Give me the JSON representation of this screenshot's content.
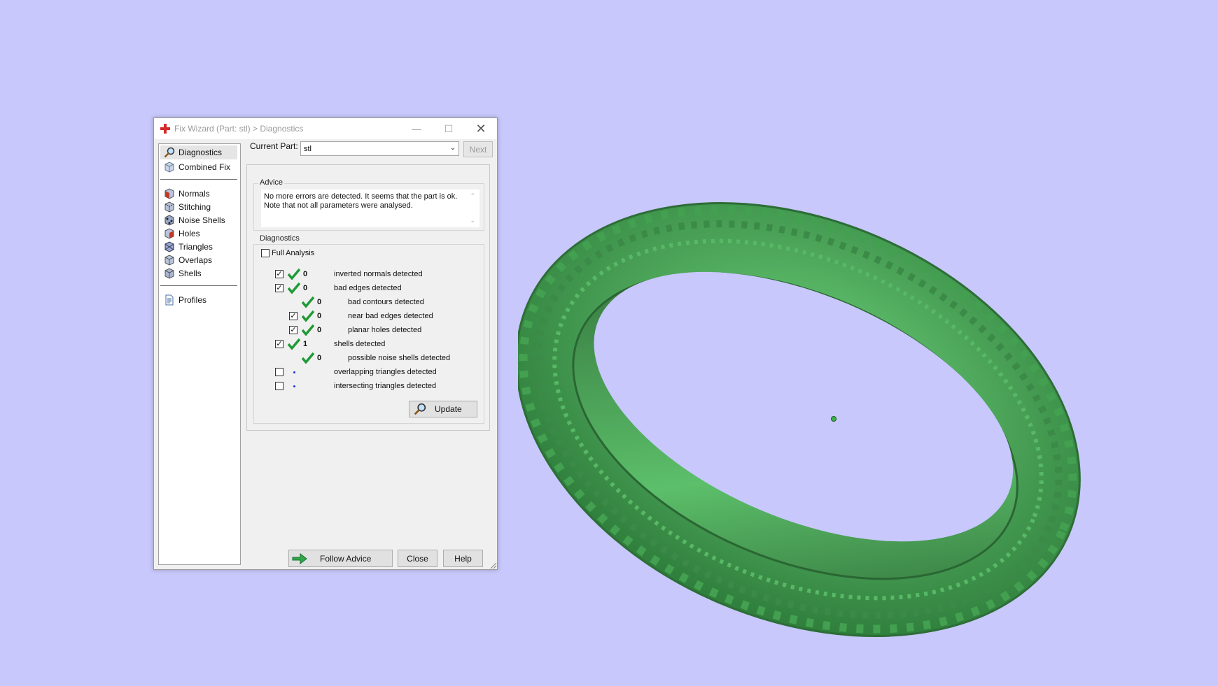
{
  "window": {
    "title": "Fix Wizard (Part: stl) > Diagnostics",
    "icon": "red-cross-icon",
    "minimize_icon": "minimize-icon",
    "maximize_icon": "maximize-icon",
    "close_icon": "close-icon"
  },
  "sidebar": {
    "items": [
      {
        "label": "Diagnostics",
        "icon": "magnifier-icon",
        "selected": true
      },
      {
        "label": "Combined Fix",
        "icon": "cube-icon",
        "selected": false
      },
      {
        "label": "Normals",
        "icon": "normals-cube-icon",
        "selected": false
      },
      {
        "label": "Stitching",
        "icon": "stitching-cube-icon",
        "selected": false
      },
      {
        "label": "Noise Shells",
        "icon": "noise-shells-icon",
        "selected": false
      },
      {
        "label": "Holes",
        "icon": "holes-cube-icon",
        "selected": false
      },
      {
        "label": "Triangles",
        "icon": "triangles-cube-icon",
        "selected": false
      },
      {
        "label": "Overlaps",
        "icon": "overlaps-cube-icon",
        "selected": false
      },
      {
        "label": "Shells",
        "icon": "shells-cube-icon",
        "selected": false
      },
      {
        "label": "Profiles",
        "icon": "document-icon",
        "selected": false
      }
    ]
  },
  "current_part": {
    "label": "Current Part:",
    "value": "stl",
    "next_label": "Next"
  },
  "advice": {
    "title": "Advice",
    "text": "No more errors are detected. It seems that the part is ok. Note that not all parameters were analysed."
  },
  "diagnostics": {
    "title": "Diagnostics",
    "full_analysis_label": "Full Analysis",
    "full_analysis_checked": false,
    "rows": [
      {
        "checked": true,
        "status": "ok",
        "count": "0",
        "label": "inverted normals detected"
      },
      {
        "checked": true,
        "status": "ok",
        "count": "0",
        "label": "bad edges detected"
      },
      {
        "checked": null,
        "status": "ok",
        "count": "0",
        "label": "bad contours detected"
      },
      {
        "checked": true,
        "status": "ok",
        "count": "0",
        "label": "near bad edges detected"
      },
      {
        "checked": true,
        "status": "ok",
        "count": "0",
        "label": "planar holes detected"
      },
      {
        "checked": true,
        "status": "ok",
        "count": "1",
        "label": "shells detected"
      },
      {
        "checked": null,
        "status": "ok",
        "count": "0",
        "label": "possible noise shells detected"
      },
      {
        "checked": false,
        "status": "not-run",
        "count": "",
        "label": "overlapping triangles detected"
      },
      {
        "checked": false,
        "status": "not-run",
        "count": "",
        "label": "intersecting triangles detected"
      }
    ],
    "update_label": "Update"
  },
  "footer": {
    "follow_advice_label": "Follow Advice",
    "close_label": "Close",
    "help_label": "Help"
  },
  "scene": {
    "background": "#c8c8fc",
    "model_color": "#4fb35f",
    "model": "green-ring-model"
  }
}
